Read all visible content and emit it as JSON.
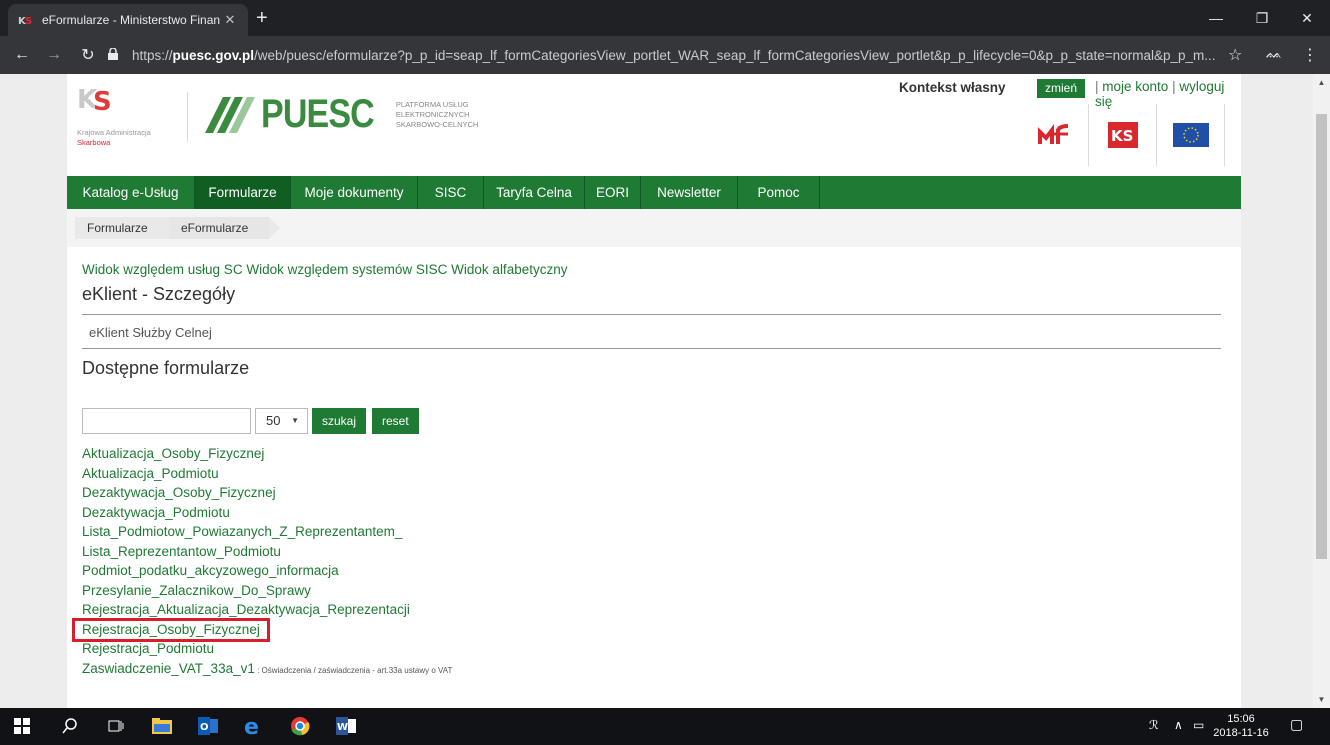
{
  "browser": {
    "tab_title": "eFormularze - Ministerstwo Finan",
    "url_prefix": "https://",
    "url_host": "puesc.gov.pl",
    "url_path": "/web/puesc/eformularze?p_p_id=seap_lf_formCategoriesView_portlet_WAR_seap_lf_formCategoriesView_portlet&p_p_lifecycle=0&p_p_state=normal&p_p_m..."
  },
  "header": {
    "kas_line1": "Krajowa Administracja",
    "kas_line2": "Skarbowa",
    "puesc_word": "PUESC",
    "puesc_tagline1": "PLATFORMA USŁUG",
    "puesc_tagline2": "ELEKTRONICZNYCH",
    "puesc_tagline3": "SKARBOWO-CELNYCH",
    "kontekst": "Kontekst własny",
    "zmien": "zmień",
    "account_link": "moje konto",
    "logout_link": "wyloguj się"
  },
  "nav": {
    "items": [
      {
        "label": "Katalog e-Usług"
      },
      {
        "label": "Formularze"
      },
      {
        "label": "Moje dokumenty"
      },
      {
        "label": "SISC"
      },
      {
        "label": "Taryfa Celna"
      },
      {
        "label": "EORI"
      },
      {
        "label": "Newsletter"
      },
      {
        "label": "Pomoc"
      }
    ]
  },
  "breadcrumb": {
    "items": [
      {
        "label": "Formularze"
      },
      {
        "label": "eFormularze"
      }
    ]
  },
  "views": {
    "services": "Widok względem usług SC",
    "systems": "Widok względem systemów SISC",
    "alpha": "Widok alfabetyczny"
  },
  "details": {
    "title": "eKlient - Szczegóły",
    "subtitle": "eKlient Służby Celnej",
    "available": "Dostępne formularze"
  },
  "search": {
    "value": "",
    "per_page": "50",
    "search_btn": "szukaj",
    "reset_btn": "reset"
  },
  "forms": [
    "Aktualizacja_Osoby_Fizycznej",
    "Aktualizacja_Podmiotu",
    "Dezaktywacja_Osoby_Fizycznej",
    "Dezaktywacja_Podmiotu",
    "Lista_Podmiotow_Powiazanych_Z_Reprezentantem_",
    "Lista_Reprezentantow_Podmiotu",
    "Podmiot_podatku_akcyzowego_informacja",
    "Przesylanie_Zalacznikow_Do_Sprawy",
    "Rejestracja_Aktualizacja_Dezaktywacja_Reprezentacji",
    "Rejestracja_Osoby_Fizycznej",
    "Rejestracja_Podmiotu",
    "Zaswiadczenie_VAT_33a_v1"
  ],
  "last_form_desc": " : Oświadczenia / zaświadczenia - art.33a ustawy o VAT",
  "taskbar": {
    "time": "15:06",
    "date": "2018-11-16"
  },
  "colors": {
    "brand_green": "#1f7a34",
    "highlight_red": "#d81e2a"
  }
}
